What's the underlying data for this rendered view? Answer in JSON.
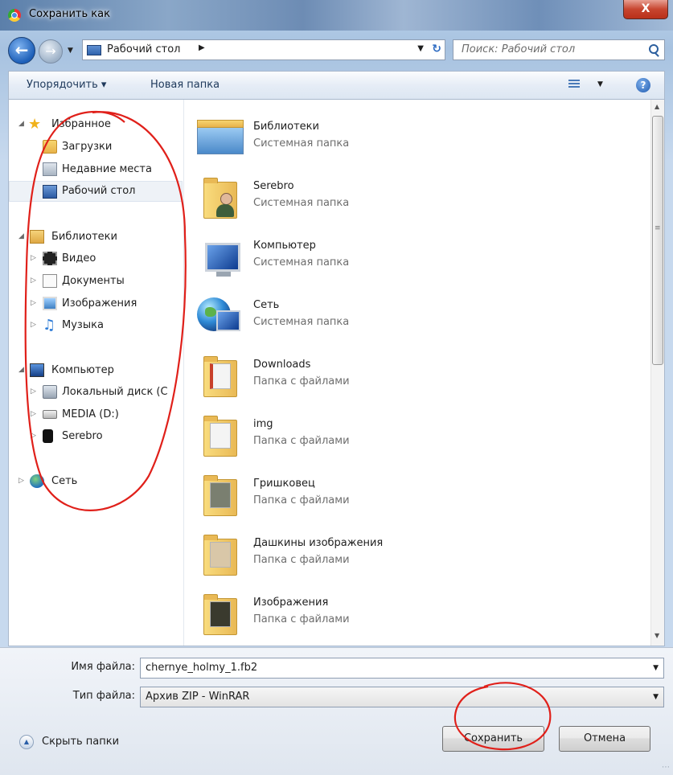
{
  "window": {
    "title": "Сохранить как",
    "close_label": "X"
  },
  "navbar": {
    "location": "Рабочий стол",
    "search_placeholder": "Поиск: Рабочий стол"
  },
  "toolbar": {
    "organize_label": "Упорядочить ▾",
    "new_folder_label": "Новая папка",
    "help_label": "?"
  },
  "navpane": {
    "favorites": {
      "label": "Избранное",
      "items": [
        {
          "label": "Загрузки",
          "icon": "downloads-folder-icon"
        },
        {
          "label": "Недавние места",
          "icon": "recent-places-icon"
        },
        {
          "label": "Рабочий стол",
          "icon": "desktop-icon",
          "selected": true
        }
      ]
    },
    "libraries": {
      "label": "Библиотеки",
      "items": [
        {
          "label": "Видео",
          "icon": "video-library-icon"
        },
        {
          "label": "Документы",
          "icon": "documents-library-icon"
        },
        {
          "label": "Изображения",
          "icon": "pictures-library-icon"
        },
        {
          "label": "Музыка",
          "icon": "music-library-icon"
        }
      ]
    },
    "computer": {
      "label": "Компьютер",
      "items": [
        {
          "label": "Локальный диск (C",
          "icon": "local-disk-icon"
        },
        {
          "label": "MEDIA (D:)",
          "icon": "drive-icon"
        },
        {
          "label": "Serebro",
          "icon": "phone-icon"
        }
      ]
    },
    "network": {
      "label": "Сеть"
    }
  },
  "files": [
    {
      "name": "Библиотеки",
      "type": "Системная папка",
      "icon": "libraries-icon"
    },
    {
      "name": "Serebro",
      "type": "Системная папка",
      "icon": "user-folder-icon"
    },
    {
      "name": "Компьютер",
      "type": "Системная папка",
      "icon": "computer-icon"
    },
    {
      "name": "Сеть",
      "type": "Системная папка",
      "icon": "network-icon"
    },
    {
      "name": "Downloads",
      "type": "Папка с файлами",
      "icon": "folder-icon"
    },
    {
      "name": "img",
      "type": "Папка с файлами",
      "icon": "folder-icon"
    },
    {
      "name": "Гришковец",
      "type": "Папка с файлами",
      "icon": "folder-icon"
    },
    {
      "name": "Дашкины изображения",
      "type": "Папка с файлами",
      "icon": "folder-icon"
    },
    {
      "name": "Изображения",
      "type": "Папка с файлами",
      "icon": "folder-icon"
    }
  ],
  "form": {
    "filename_label": "Имя файла:",
    "filename_value": "chernye_holmy_1.fb2",
    "filetype_label": "Тип файла:",
    "filetype_value": "Архив ZIP - WinRAR",
    "hide_folders_label": "Скрыть папки",
    "save_label": "Сохранить",
    "cancel_label": "Отмена"
  },
  "colors": {
    "annotation_red": "#e0201a",
    "selection_bg": "#eef2f7"
  }
}
